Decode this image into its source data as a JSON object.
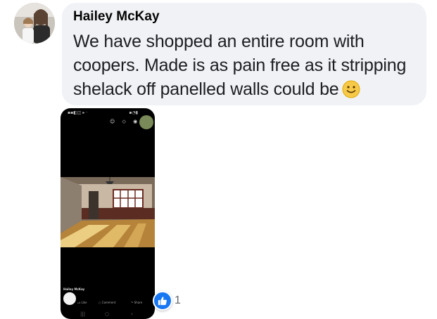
{
  "comment": {
    "author": "Hailey McKay",
    "text": "We have shopped an entire room with coopers. Made is as pain free as it stripping shelack off panelled walls could be",
    "emoji_icon": "slightly-smiling-face-icon"
  },
  "attachment": {
    "post_author": "Hailey McKay",
    "actions": {
      "like": "Like",
      "comment": "Comment",
      "share": "Share"
    }
  },
  "reactions": {
    "icon": "like-thumb-icon",
    "count": "1",
    "color": "#1877f2"
  },
  "colors": {
    "bubble": "#f0f2f5",
    "text": "#1c1e21",
    "emoji": "#f7c948"
  }
}
